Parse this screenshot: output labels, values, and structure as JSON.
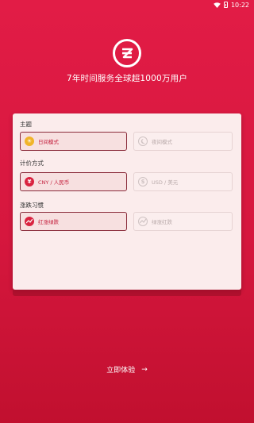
{
  "status": {
    "time": "10:22"
  },
  "tagline": "7年时间服务全球超1000万用户",
  "sections": {
    "theme": {
      "label": "主题",
      "options": [
        {
          "label": "日间模式",
          "icon": "sun-icon",
          "selected": true
        },
        {
          "label": "夜间模式",
          "icon": "moon-icon",
          "selected": false
        }
      ]
    },
    "pricing": {
      "label": "计价方式",
      "options": [
        {
          "label": "CNY / 人民币",
          "icon": "yen-icon",
          "selected": true
        },
        {
          "label": "USD / 美元",
          "icon": "dollar-icon",
          "selected": false
        }
      ]
    },
    "color_habit": {
      "label": "涨跌习惯",
      "options": [
        {
          "label": "红涨绿跌",
          "icon": "red-up-icon",
          "selected": true
        },
        {
          "label": "绿涨红跌",
          "icon": "green-up-icon",
          "selected": false
        }
      ]
    }
  },
  "cta": {
    "label": "立即体验",
    "arrow": "→"
  },
  "colors": {
    "accent": "#d9223f",
    "background": "#e21c46",
    "card": "#fbecec"
  }
}
